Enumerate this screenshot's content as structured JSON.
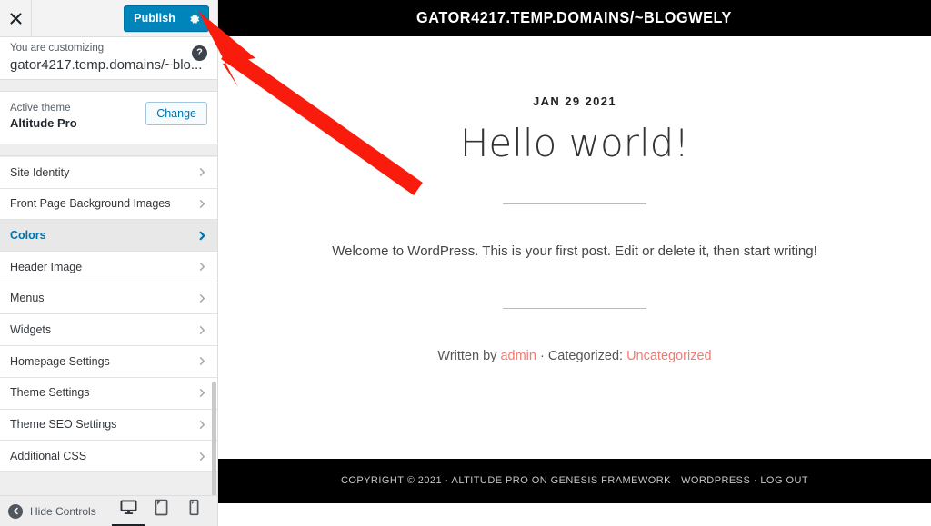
{
  "customizer": {
    "close_icon": "close-icon",
    "publish": {
      "label": "Publish",
      "gear_icon": "gear-icon",
      "color": "#0085ba"
    },
    "info": {
      "label": "You are customizing",
      "site": "gator4217.temp.domains/~blo...",
      "help_icon": "?"
    },
    "theme": {
      "active_label": "Active theme",
      "name": "Altitude Pro",
      "change_label": "Change"
    },
    "nav_items": [
      {
        "label": "Site Identity",
        "active": false
      },
      {
        "label": "Front Page Background Images",
        "active": false
      },
      {
        "label": "Colors",
        "active": true
      },
      {
        "label": "Header Image",
        "active": false
      },
      {
        "label": "Menus",
        "active": false
      },
      {
        "label": "Widgets",
        "active": false
      },
      {
        "label": "Homepage Settings",
        "active": false
      },
      {
        "label": "Theme Settings",
        "active": false
      },
      {
        "label": "Theme SEO Settings",
        "active": false
      },
      {
        "label": "Additional CSS",
        "active": false
      }
    ],
    "footer": {
      "hide_controls_label": "Hide Controls",
      "collapse_icon": "collapse-arrow-icon",
      "devices": [
        {
          "name": "desktop",
          "active": true
        },
        {
          "name": "tablet",
          "active": false
        },
        {
          "name": "mobile",
          "active": false
        }
      ]
    }
  },
  "preview": {
    "site_title": "GATOR4217.TEMP.DOMAINS/~BLOGWELY",
    "post": {
      "date": "JAN 29 2021",
      "title": "Hello world!",
      "content": "Welcome to WordPress. This is your first post. Edit or delete it, then start writing!",
      "meta_prefix": "Written by ",
      "meta_author": "admin",
      "meta_separator": " · Categorized: ",
      "meta_category": "Uncategorized",
      "link_color": "#f07b72"
    },
    "footer_text": "COPYRIGHT © 2021 · ALTITUDE PRO ON GENESIS FRAMEWORK · WORDPRESS · LOG OUT"
  },
  "annotation": {
    "arrow_color": "#f91c0d",
    "arrow_target": "publish-gear-icon"
  }
}
